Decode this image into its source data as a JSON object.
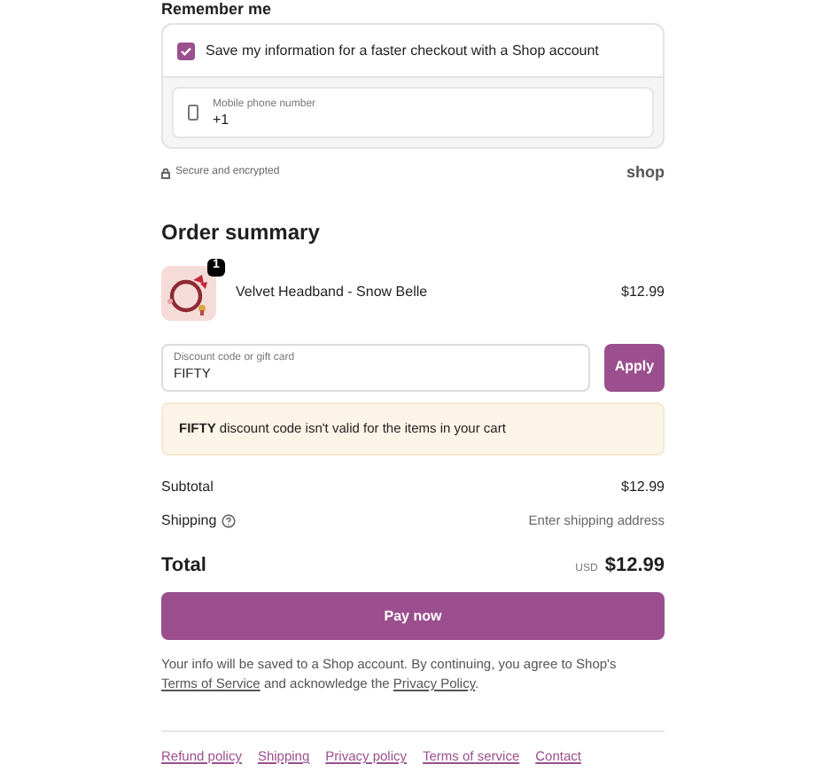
{
  "remember_me": {
    "title": "Remember me",
    "save_info": {
      "label": "Save my information for a faster checkout with a Shop account",
      "checked": true
    },
    "phone": {
      "label": "Mobile phone number",
      "value": "+1"
    }
  },
  "secure_note": "Secure and encrypted",
  "shop_logo": "shop",
  "order_summary": {
    "title": "Order summary",
    "items": [
      {
        "quantity": "1",
        "name": "Velvet Headband - Snow Belle",
        "price": "$12.99"
      }
    ],
    "discount": {
      "label": "Discount code or gift card",
      "value": "FIFTY",
      "button": "Apply"
    },
    "error": "**FIFTY** discount code isn't valid for the items in your cart",
    "subtotal": {
      "label": "Subtotal",
      "value": "$12.99"
    },
    "shipping": {
      "label": "Shipping",
      "value": "Enter shipping address"
    },
    "total": {
      "label": "Total",
      "currency": "USD",
      "value": "$12.99"
    },
    "pay_button": "Pay now",
    "legal": {
      "text": "Your info will be saved to a Shop account. By continuing, you agree to Shop's",
      "link_1": "Terms of Service",
      "middle": "and acknowledge the",
      "link_2": "Privacy Policy",
      "end": "."
    }
  },
  "footer_links": [
    "Refund policy",
    "Shipping",
    "Privacy policy",
    "Terms of service",
    "Contact"
  ]
}
